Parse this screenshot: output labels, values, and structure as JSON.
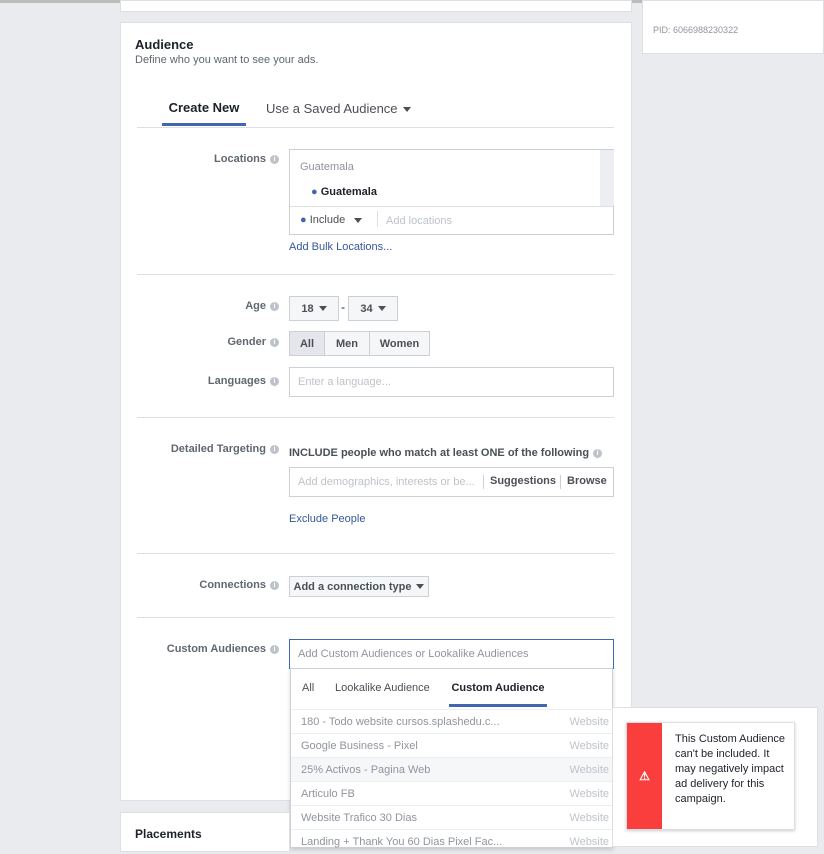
{
  "side": {
    "pid": "PID: 6066988230322"
  },
  "audience": {
    "title": "Audience",
    "subtitle": "Define who you want to see your ads.",
    "tabs": [
      {
        "label": "Create New"
      },
      {
        "label": "Use a Saved Audience"
      }
    ],
    "locations": {
      "label": "Locations",
      "search_value": "Guatemala",
      "selected": "Guatemala",
      "include": "Include",
      "placeholder": "Add locations",
      "bulk": "Add Bulk Locations..."
    },
    "age": {
      "label": "Age",
      "min": "18",
      "max": "34",
      "sep": "-"
    },
    "gender": {
      "label": "Gender",
      "options": [
        "All",
        "Men",
        "Women"
      ],
      "selected": "All"
    },
    "languages": {
      "label": "Languages",
      "placeholder": "Enter a language..."
    },
    "detailed": {
      "label": "Detailed Targeting",
      "desc": "INCLUDE people who match at least ONE of the following",
      "placeholder": "Add demographics, interests or be...",
      "suggestions": "Suggestions",
      "browse": "Browse",
      "exclude": "Exclude People"
    },
    "connections": {
      "label": "Connections",
      "button": "Add a connection type"
    },
    "custom": {
      "label": "Custom Audiences",
      "placeholder": "Add Custom Audiences or Lookalike Audiences",
      "tabs": [
        {
          "label": "All"
        },
        {
          "label": "Lookalike Audience"
        },
        {
          "label": "Custom Audience"
        }
      ],
      "items": [
        {
          "name": "180 - Todo website cursos.splashedu.c...",
          "type": "Website"
        },
        {
          "name": "Google Business - Pixel",
          "type": "Website"
        },
        {
          "name": "25% Activos - Pagina Web",
          "type": "Website"
        },
        {
          "name": "Articulo FB",
          "type": "Website"
        },
        {
          "name": "Website Trafico 30 Dias",
          "type": "Website"
        },
        {
          "name": "Landing + Thank You 60 Dias Pixel Fac...",
          "type": "Website"
        }
      ]
    }
  },
  "placements": {
    "title": "Placements"
  },
  "warning": {
    "text": "This Custom Audience can't be included. It may negatively impact ad delivery for this campaign.",
    "color": "#fa3e3e"
  }
}
